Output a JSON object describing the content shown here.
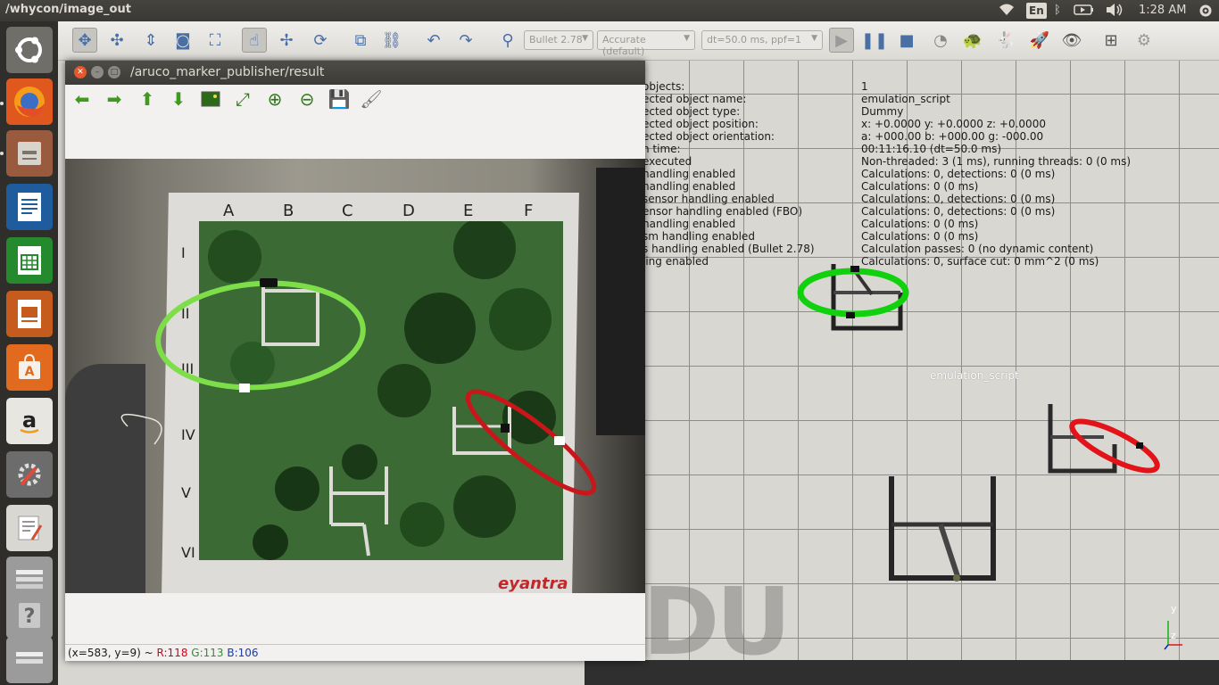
{
  "top_panel": {
    "title": "/whycon/image_out",
    "lang": "En",
    "clock": "1:28 AM"
  },
  "launcher": {
    "items": [
      {
        "name": "dash-home",
        "icon": "ubuntu-logo-icon",
        "color": "#6f6e69"
      },
      {
        "name": "firefox",
        "icon": "firefox-icon",
        "color": "#e0581d"
      },
      {
        "name": "files",
        "icon": "file-cabinet-icon",
        "color": "#9a5a3e"
      },
      {
        "name": "writer",
        "icon": "document-icon",
        "color": "#1f5c9e"
      },
      {
        "name": "calc",
        "icon": "spreadsheet-icon",
        "color": "#25892d"
      },
      {
        "name": "impress",
        "icon": "presentation-icon",
        "color": "#c55b1d"
      },
      {
        "name": "software-center",
        "icon": "shopping-bag-icon",
        "color": "#e16a1f"
      },
      {
        "name": "amazon",
        "icon": "amazon-icon",
        "color": "#e8e6e1"
      },
      {
        "name": "system-settings",
        "icon": "wrench-gear-icon",
        "color": "#6c6c6c"
      },
      {
        "name": "text-editor",
        "icon": "text-editor-icon",
        "color": "#d9d7d2"
      },
      {
        "name": "stack-app",
        "icon": "stack-icon",
        "color": "#9b9b9b"
      },
      {
        "name": "help",
        "icon": "help-icon",
        "color": "#9b9b9b"
      },
      {
        "name": "workspaces",
        "icon": "stack-icon",
        "color": "#9b9b9b"
      }
    ]
  },
  "vrep": {
    "engine_select": "Bullet 2.78",
    "accuracy_select": "Accurate (default)",
    "dt_select": "dt=50.0 ms, ppf=1",
    "info_rows": [
      {
        "label": "objects:",
        "value": "1"
      },
      {
        "label": "ected object name:",
        "value": "emulation_script"
      },
      {
        "label": "ected object type:",
        "value": "Dummy"
      },
      {
        "label": "ected object position:",
        "value": "x: +0.0000   y: +0.0000   z: +0.0000"
      },
      {
        "label": "ected object orientation:",
        "value": "a: +000.00   b: +000.00   g: -000.00"
      },
      {
        "label": "n time:",
        "value": "00:11:16.10 (dt=50.0 ms)"
      },
      {
        "label": "executed",
        "value": "Non-threaded: 3 (1 ms), running threads: 0 (0 ms)"
      },
      {
        "label": " handling enabled",
        "value": "Calculations: 0, detections: 0 (0 ms)"
      },
      {
        "label": " handling enabled",
        "value": "Calculations: 0 (0 ms)"
      },
      {
        "label": " sensor handling enabled",
        "value": "Calculations: 0, detections: 0 (0 ms)"
      },
      {
        "label": "ensor handling enabled (FBO)",
        "value": "Calculations: 0, detections: 0 (0 ms)"
      },
      {
        "label": "handling enabled",
        "value": "Calculations: 0 (0 ms)"
      },
      {
        "label": "sm handling enabled",
        "value": "Calculations: 0 (0 ms)"
      },
      {
        "label": "s handling enabled (Bullet 2.78)",
        "value": "Calculation passes: 0 (no dynamic content)"
      },
      {
        "label": "ling enabled",
        "value": "Calculations: 0, surface cut: 0 mm^2 (0 ms)"
      }
    ],
    "dummy_label": "emulation_script",
    "watermark": "DU",
    "axis_y": "y",
    "axis_z": "z"
  },
  "image_view": {
    "title": "/aruco_marker_publisher/result",
    "status_coords": "(x=583, y=9) ~",
    "status_r": "R:118",
    "status_g": "G:113",
    "status_b": "B:106",
    "colors": {
      "r": "#d0021b",
      "g": "#2f8f2f",
      "b": "#1b3aa6"
    },
    "arena": {
      "columns": [
        "A",
        "B",
        "C",
        "D",
        "E",
        "F"
      ],
      "rows": [
        "I",
        "II",
        "III",
        "IV",
        "V",
        "VI"
      ],
      "brand": "eyantra"
    }
  }
}
